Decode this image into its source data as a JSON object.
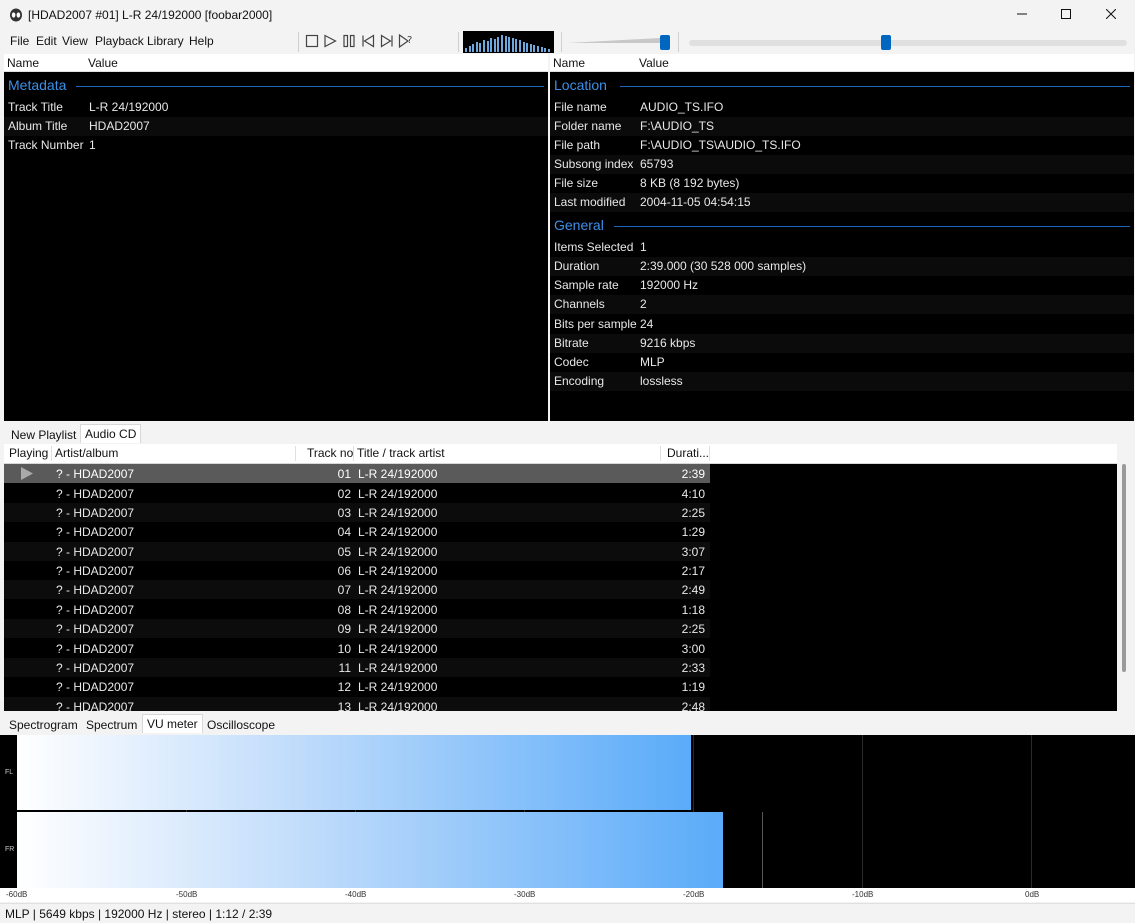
{
  "window": {
    "title": "[HDAD2007 #01] L-R 24/192000  [foobar2000]",
    "minimize_icon": "minimize-icon",
    "maximize_icon": "maximize-icon",
    "close_icon": "close-icon"
  },
  "menu": [
    "File",
    "Edit",
    "View",
    "Playback",
    "Library",
    "Help"
  ],
  "toolbar": {
    "buttons": [
      "stop-icon",
      "play-icon",
      "pause-icon",
      "previous-icon",
      "next-icon",
      "random-icon"
    ],
    "volume_level": 0.95,
    "seek_position": 0.45,
    "accent_color": "#0067c0"
  },
  "left_panel": {
    "col_name": "Name",
    "col_value": "Value",
    "sections": [
      {
        "title": "Metadata",
        "rows": [
          {
            "name": "Track Title",
            "value": "L-R 24/192000"
          },
          {
            "name": "Album Title",
            "value": "HDAD2007"
          },
          {
            "name": "Track Number",
            "value": "1"
          }
        ]
      }
    ]
  },
  "right_panel": {
    "col_name": "Name",
    "col_value": "Value",
    "sections": [
      {
        "title": "Location",
        "rows": [
          {
            "name": "File name",
            "value": "AUDIO_TS.IFO"
          },
          {
            "name": "Folder name",
            "value": "F:\\AUDIO_TS"
          },
          {
            "name": "File path",
            "value": "F:\\AUDIO_TS\\AUDIO_TS.IFO"
          },
          {
            "name": "Subsong index",
            "value": "65793"
          },
          {
            "name": "File size",
            "value": "8 KB (8 192 bytes)"
          },
          {
            "name": "Last modified",
            "value": "2004-11-05 04:54:15"
          }
        ]
      },
      {
        "title": "General",
        "rows": [
          {
            "name": "Items Selected",
            "value": "1"
          },
          {
            "name": "Duration",
            "value": "2:39.000 (30 528 000 samples)"
          },
          {
            "name": "Sample rate",
            "value": "192000 Hz"
          },
          {
            "name": "Channels",
            "value": "2"
          },
          {
            "name": "Bits per sample",
            "value": "24"
          },
          {
            "name": "Bitrate",
            "value": "9216 kbps"
          },
          {
            "name": "Codec",
            "value": "MLP"
          },
          {
            "name": "Encoding",
            "value": "lossless"
          }
        ]
      }
    ]
  },
  "playlist_tabs": [
    "New Playlist",
    "Audio CD"
  ],
  "playlist_active_tab": 1,
  "playlist": {
    "columns": [
      "Playing",
      "Artist/album",
      "Track no",
      "Title / track artist",
      "Durati..."
    ],
    "playing_index": 0,
    "playing_icon": "play-indicator-icon",
    "rows": [
      {
        "artist": "? - HDAD2007",
        "track": "01",
        "title": "L-R 24/192000",
        "duration": "2:39"
      },
      {
        "artist": "? - HDAD2007",
        "track": "02",
        "title": "L-R 24/192000",
        "duration": "4:10"
      },
      {
        "artist": "? - HDAD2007",
        "track": "03",
        "title": "L-R 24/192000",
        "duration": "2:25"
      },
      {
        "artist": "? - HDAD2007",
        "track": "04",
        "title": "L-R 24/192000",
        "duration": "1:29"
      },
      {
        "artist": "? - HDAD2007",
        "track": "05",
        "title": "L-R 24/192000",
        "duration": "3:07"
      },
      {
        "artist": "? - HDAD2007",
        "track": "06",
        "title": "L-R 24/192000",
        "duration": "2:17"
      },
      {
        "artist": "? - HDAD2007",
        "track": "07",
        "title": "L-R 24/192000",
        "duration": "2:49"
      },
      {
        "artist": "? - HDAD2007",
        "track": "08",
        "title": "L-R 24/192000",
        "duration": "1:18"
      },
      {
        "artist": "? - HDAD2007",
        "track": "09",
        "title": "L-R 24/192000",
        "duration": "2:25"
      },
      {
        "artist": "? - HDAD2007",
        "track": "10",
        "title": "L-R 24/192000",
        "duration": "3:00"
      },
      {
        "artist": "? - HDAD2007",
        "track": "11",
        "title": "L-R 24/192000",
        "duration": "2:33"
      },
      {
        "artist": "? - HDAD2007",
        "track": "12",
        "title": "L-R 24/192000",
        "duration": "1:19"
      },
      {
        "artist": "? - HDAD2007",
        "track": "13",
        "title": "L-R 24/192000",
        "duration": "2:48"
      }
    ]
  },
  "vis_tabs": [
    "Spectrogram",
    "Spectrum",
    "VU meter",
    "Oscilloscope"
  ],
  "vis_active_tab": 2,
  "vu_meter": {
    "scale": [
      "-60dB",
      "-50dB",
      "-40dB",
      "-30dB",
      "-20dB",
      "-10dB",
      "0dB"
    ],
    "scale_min_db": -60,
    "scale_max_db": 0,
    "channels": [
      {
        "label": "FL",
        "level_db": -20.1,
        "peak_db": null
      },
      {
        "label": "FR",
        "level_db": -18.2,
        "peak_db": -15.9
      }
    ]
  },
  "status": "MLP | 5649 kbps | 192000 Hz | stereo | 1:12 / 2:39"
}
